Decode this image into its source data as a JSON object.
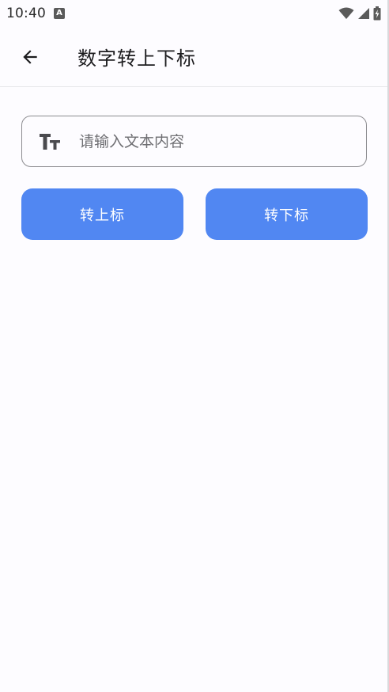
{
  "status_bar": {
    "time": "10:40",
    "notification_glyph": "A",
    "icons": [
      "wifi-icon",
      "cell-signal-icon",
      "battery-charging-icon"
    ]
  },
  "app_bar": {
    "title": "数字转上下标",
    "back_icon": "arrow-back-icon"
  },
  "input": {
    "placeholder": "请输入文本内容",
    "value": "",
    "leading_icon": "text-fields-icon"
  },
  "buttons": {
    "superscript_label": "转上标",
    "subscript_label": "转下标",
    "color": "#5187f2"
  }
}
